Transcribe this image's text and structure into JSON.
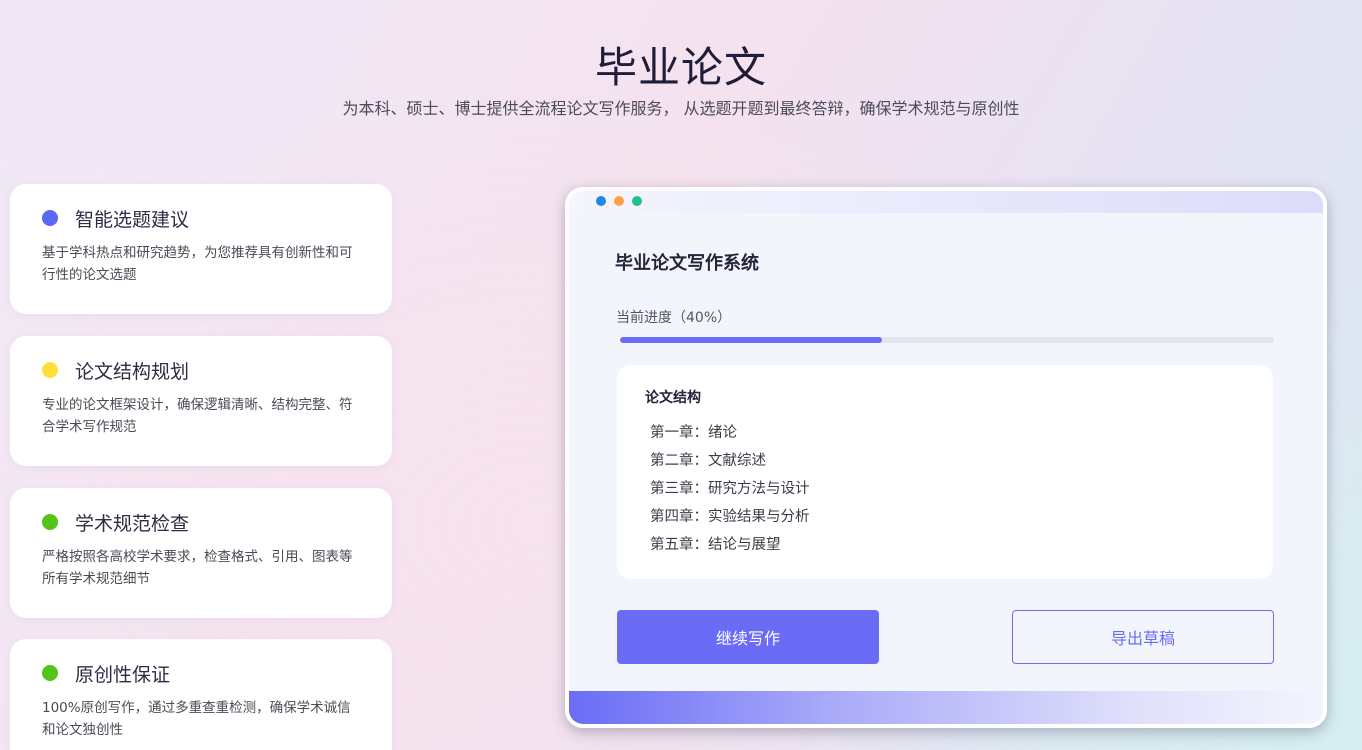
{
  "header": {
    "title": "毕业论文",
    "subtitle": "为本科、硕士、博士提供全流程论文写作服务， 从选题开题到最终答辩，确保学术规范与原创性"
  },
  "features": [
    {
      "title": "智能选题建议",
      "desc": "基于学科热点和研究趋势，为您推荐具有创新性和可行性的论文选题",
      "dot_color": "#5b67f5"
    },
    {
      "title": "论文结构规划",
      "desc": "专业的论文框架设计，确保逻辑清晰、结构完整、符合学术写作规范",
      "dot_color": "#ffe03a"
    },
    {
      "title": "学术规范检查",
      "desc": "严格按照各高校学术要求，检查格式、引用、图表等所有学术规范细节",
      "dot_color": "#52c41a"
    },
    {
      "title": "原创性保证",
      "desc": "100%原创写作，通过多重查重检测，确保学术诚信和论文独创性",
      "dot_color": "#52c41a"
    }
  ],
  "window": {
    "dots": [
      "#1e88e5",
      "#ffa245",
      "#1ec28b"
    ],
    "app_title": "毕业论文写作系统",
    "progress_label": "当前进度（40%）",
    "progress_value": 0.4,
    "outline": {
      "heading": "论文结构",
      "chapters": [
        "第一章：绪论",
        "第二章：文献综述",
        "第三章：研究方法与设计",
        "第四章：实验结果与分析",
        "第五章：结论与展望"
      ]
    },
    "continue_button": "继续写作",
    "export_button": "导出草稿"
  },
  "colors": {
    "accent": "#6a6cf6"
  }
}
